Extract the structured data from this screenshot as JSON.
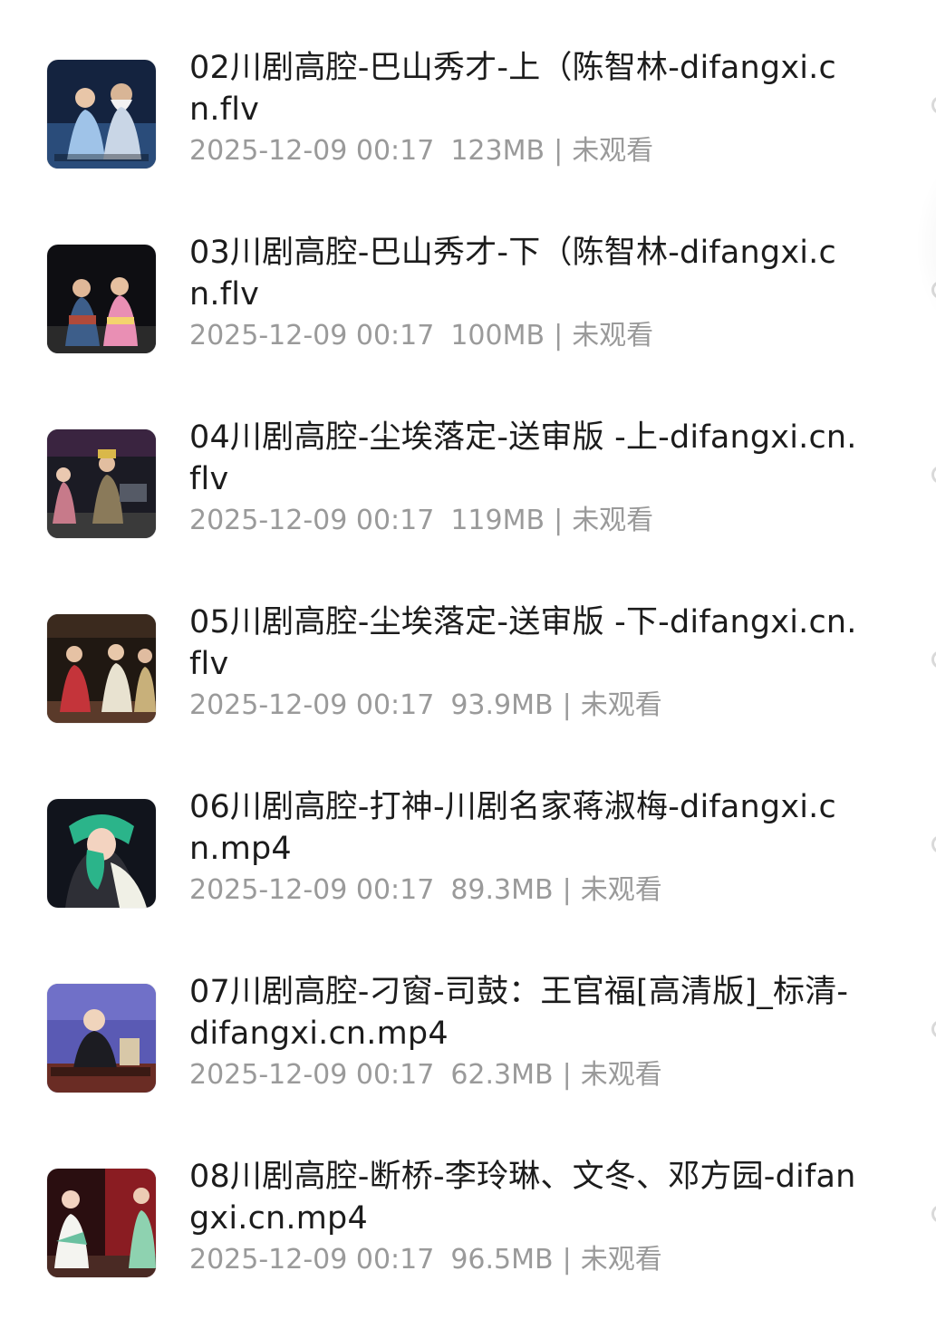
{
  "files": [
    {
      "title": "02川剧高腔-巴山秀才-上（陈智林-difangxi.cn.flv",
      "date": "2025-12-09 00:17",
      "size": "123MB",
      "status": "未观看",
      "thumb_icon": "opera-stage-thumbnail"
    },
    {
      "title": "03川剧高腔-巴山秀才-下（陈智林-difangxi.cn.flv",
      "date": "2025-12-09 00:17",
      "size": "100MB",
      "status": "未观看",
      "thumb_icon": "opera-stage-thumbnail"
    },
    {
      "title": "04川剧高腔-尘埃落定-送审版 -上-difangxi.cn.flv",
      "date": "2025-12-09 00:17",
      "size": "119MB",
      "status": "未观看",
      "thumb_icon": "opera-stage-thumbnail"
    },
    {
      "title": "05川剧高腔-尘埃落定-送审版 -下-difangxi.cn.flv",
      "date": "2025-12-09 00:17",
      "size": "93.9MB",
      "status": "未观看",
      "thumb_icon": "opera-stage-thumbnail"
    },
    {
      "title": "06川剧高腔-打神-川剧名家蒋淑梅-difangxi.cn.mp4",
      "date": "2025-12-09 00:17",
      "size": "89.3MB",
      "status": "未观看",
      "thumb_icon": "opera-stage-thumbnail"
    },
    {
      "title": "07川剧高腔-刁窗-司鼓：王官福[高清版]_标清-difangxi.cn.mp4",
      "date": "2025-12-09 00:17",
      "size": "62.3MB",
      "status": "未观看",
      "thumb_icon": "opera-stage-thumbnail"
    },
    {
      "title": "08川剧高腔-断桥-李玲琳、文冬、邓方园-difangxi.cn.mp4",
      "date": "2025-12-09 00:17",
      "size": "96.5MB",
      "status": "未观看",
      "thumb_icon": "opera-stage-thumbnail"
    }
  ],
  "meta_separator": "|",
  "colors": {
    "title": "#1c1c1c",
    "meta": "#9a9a9a",
    "radio_border": "#d9d9d9"
  }
}
